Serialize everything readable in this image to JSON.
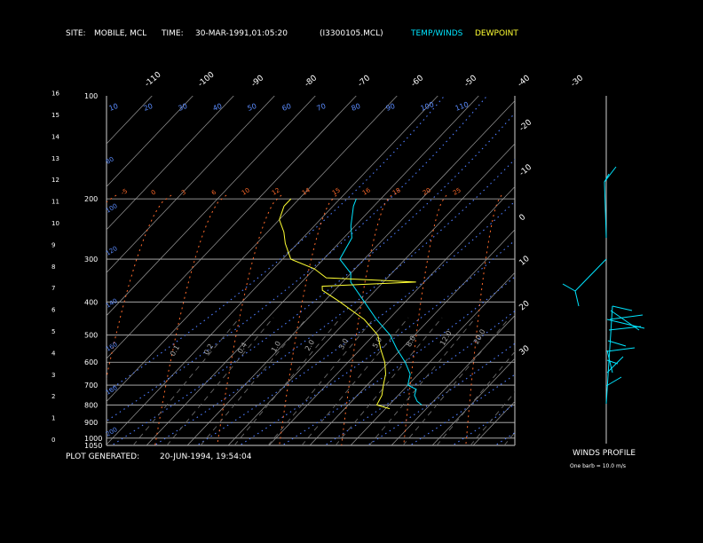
{
  "header": {
    "site_label": "SITE:",
    "site_value": "MOBILE, MCL",
    "time_label": "TIME:",
    "time_value": "30-MAR-1991,01:05:20",
    "file": "(I3300105.MCL)",
    "temp_winds_label": "TEMP/WINDS",
    "dewpoint_label": "DEWPOINT",
    "temp_color": "#00e5ff",
    "dew_color": "#ffff33"
  },
  "footer": {
    "generated_label": "PLOT GENERATED:",
    "generated_value": "20-JUN-1994, 19:54:04"
  },
  "winds": {
    "title": "WINDS PROFILE",
    "note": "One barb = 10.0 m/s"
  },
  "chart_data": {
    "type": "line",
    "subtype": "skew-T log-P thermodynamic diagram",
    "pressure_levels": [
      "100",
      "200",
      "300",
      "400",
      "500",
      "600",
      "700",
      "800",
      "900",
      "1000",
      "1050"
    ],
    "height_ticks": [
      "0",
      "1",
      "2",
      "3",
      "4",
      "5",
      "6",
      "7",
      "8",
      "9",
      "10",
      "11",
      "12",
      "13",
      "14",
      "15",
      "16"
    ],
    "isotherm_labels": [
      "-110",
      "-100",
      "-90",
      "-80",
      "-70",
      "-60",
      "-50",
      "-40",
      "-30",
      "-20",
      "-10",
      "0",
      "10",
      "20",
      "30"
    ],
    "dry_adiabat_labels": [
      "10",
      "20",
      "30",
      "40",
      "50",
      "60",
      "70",
      "80",
      "90",
      "100",
      "110"
    ],
    "moist_adiabat_labels": [
      "-5",
      "0",
      "3",
      "6",
      "10",
      "12",
      "14",
      "15",
      "16",
      "18",
      "20",
      "25"
    ],
    "mixing_ratio_labels": [
      "0.1",
      "0.2",
      "0.4",
      "1.0",
      "2.0",
      "3.0",
      "5.0",
      "8.0",
      "12.0",
      "20.0"
    ],
    "temperature": {
      "name": "TEMP/WINDS",
      "pressure": [
        800,
        780,
        750,
        720,
        700,
        650,
        600,
        550,
        500,
        450,
        400,
        350,
        330,
        300,
        260,
        240,
        210,
        200
      ],
      "temp": [
        8,
        6,
        4,
        3,
        0,
        -2,
        -6,
        -11,
        -16,
        -23,
        -30,
        -38,
        -40,
        -46,
        -48,
        -51,
        -55,
        -56
      ]
    },
    "dewpoint": {
      "name": "DEWPOINT",
      "pressure": [
        820,
        800,
        750,
        700,
        650,
        600,
        550,
        500,
        450,
        400,
        370,
        360,
        350,
        340,
        320,
        300,
        270,
        250,
        230,
        210,
        200
      ],
      "temp": [
        1,
        -3,
        -4,
        -6,
        -8,
        -11,
        -15,
        -19,
        -26,
        -36,
        -43,
        -44,
        -22,
        -45,
        -50,
        -58,
        -63,
        -66,
        -70,
        -72,
        -72
      ]
    },
    "wind_profile": {
      "unit_per_barb": 10.0,
      "shaft_speeds": [
        10,
        12,
        14,
        16,
        18,
        20,
        15,
        18,
        22,
        25,
        20,
        15
      ]
    }
  }
}
